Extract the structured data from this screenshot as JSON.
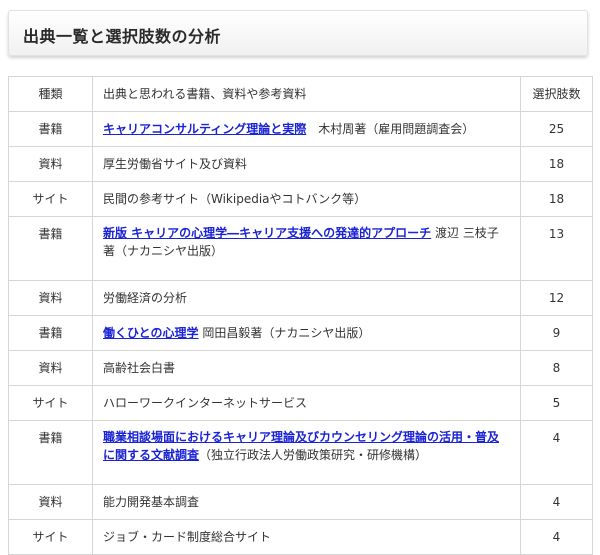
{
  "page": {
    "title": "出典一覧と選択肢数の分析"
  },
  "table": {
    "headers": {
      "type": "種類",
      "source": "出典と思われる書籍、資料や参考資料",
      "count": "選択肢数"
    },
    "rows": [
      {
        "type": "書籍",
        "link": "キャリアコンサルティング理論と実際",
        "text": "　木村周著（雇用問題調査会）",
        "count": "25"
      },
      {
        "type": "資料",
        "link": "",
        "text": "厚生労働省サイト及び資料",
        "count": "18"
      },
      {
        "type": "サイト",
        "link": "",
        "text": "民間の参考サイト（Wikipediaやコトバンク等）",
        "count": "18"
      },
      {
        "type": "書籍",
        "link": "新版 キャリアの心理学―キャリア支援への発達的アプローチ",
        "text": " 渡辺 三枝子著（ナカニシヤ出版）",
        "count": "13"
      },
      {
        "type": "資料",
        "link": "",
        "text": "労働経済の分析",
        "count": "12"
      },
      {
        "type": "書籍",
        "link": "働くひとの心理学",
        "text": " 岡田昌毅著（ナカニシヤ出版）",
        "count": "9"
      },
      {
        "type": "資料",
        "link": "",
        "text": "高齢社会白書",
        "count": "8"
      },
      {
        "type": "サイト",
        "link": "",
        "text": "ハローワークインターネットサービス",
        "count": "5"
      },
      {
        "type": "書籍",
        "link": "職業相談場面におけるキャリア理論及びカウンセリング理論の活用・普及に関する文献調査",
        "text": "（独立行政法人労働政策研究・研修機構）",
        "count": "4"
      },
      {
        "type": "資料",
        "link": "",
        "text": "能力開発基本調査",
        "count": "4"
      },
      {
        "type": "サイト",
        "link": "",
        "text": "ジョブ・カード制度総合サイト",
        "count": "4"
      }
    ]
  }
}
